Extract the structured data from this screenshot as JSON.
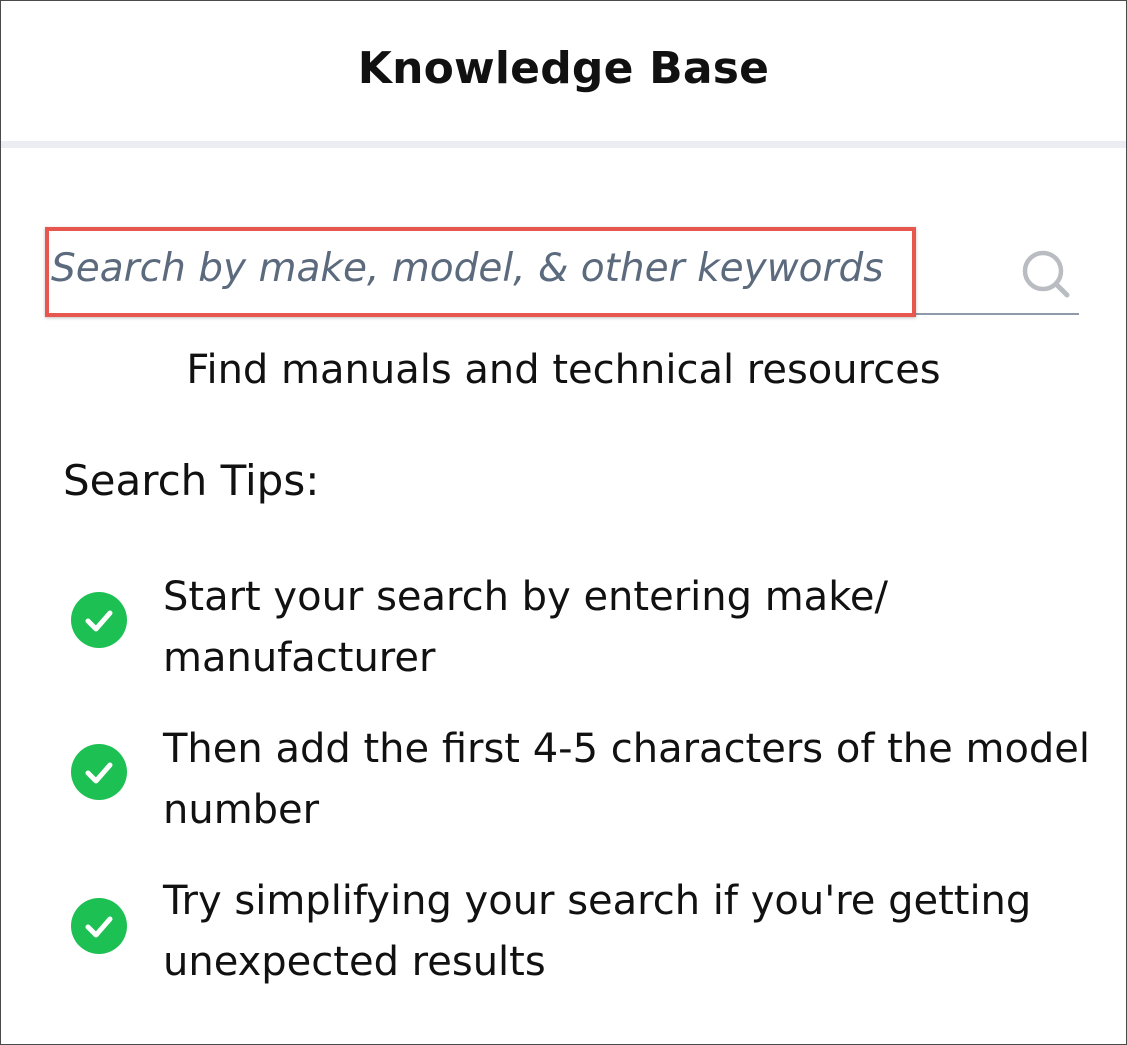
{
  "header": {
    "title": "Knowledge Base"
  },
  "search": {
    "placeholder": "Search by make, model, & other keywords",
    "value": "",
    "button_icon": "search-icon"
  },
  "subtitle": "Find manuals and technical resources",
  "tips": {
    "heading": "Search Tips:",
    "icon": "check-circle-icon",
    "items": [
      {
        "text": "Start your search by entering make/ manufacturer"
      },
      {
        "text": "Then add the first 4-5 characters of the model number"
      },
      {
        "text": "Try simplifying your search if you're getting unexpected results"
      }
    ]
  },
  "colors": {
    "highlight": "#e8574d",
    "check": "#1cc053",
    "placeholder": "#5b6a7d",
    "underline": "#8f9bab",
    "divider": "#ebedf3"
  }
}
